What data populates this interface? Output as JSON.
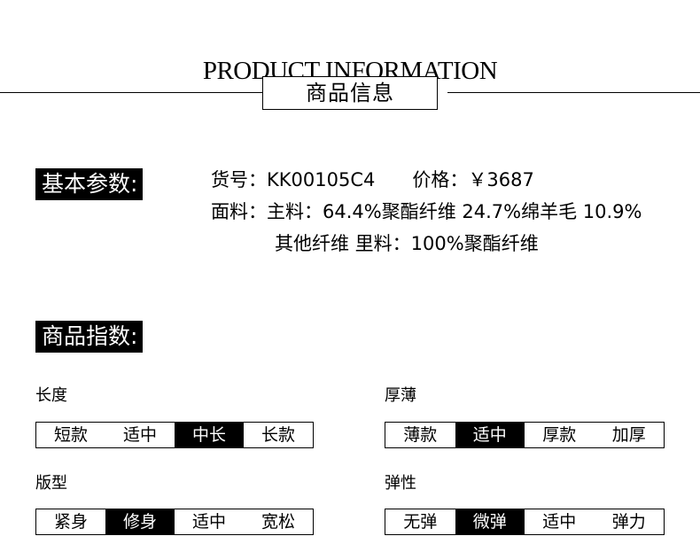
{
  "header": {
    "title_en": "PRODUCT INFORMATION",
    "title_cn": "商品信息"
  },
  "basic": {
    "label": "基本参数:",
    "line1": "货号：KK00105C4　　价格：￥3687",
    "line2": "面料：主料：64.4%聚酯纤维 24.7%绵羊毛 10.9%",
    "line3": "其他纤维 里料：100%聚酯纤维"
  },
  "index": {
    "label": "商品指数:",
    "groups": [
      {
        "title": "长度",
        "options": [
          "短款",
          "适中",
          "中长",
          "长款"
        ],
        "selected": 2
      },
      {
        "title": "厚薄",
        "options": [
          "薄款",
          "适中",
          "厚款",
          "加厚"
        ],
        "selected": 1
      },
      {
        "title": "版型",
        "options": [
          "紧身",
          "修身",
          "适中",
          "宽松"
        ],
        "selected": 1
      },
      {
        "title": "弹性",
        "options": [
          "无弹",
          "微弹",
          "适中",
          "弹力"
        ],
        "selected": 1
      }
    ]
  }
}
